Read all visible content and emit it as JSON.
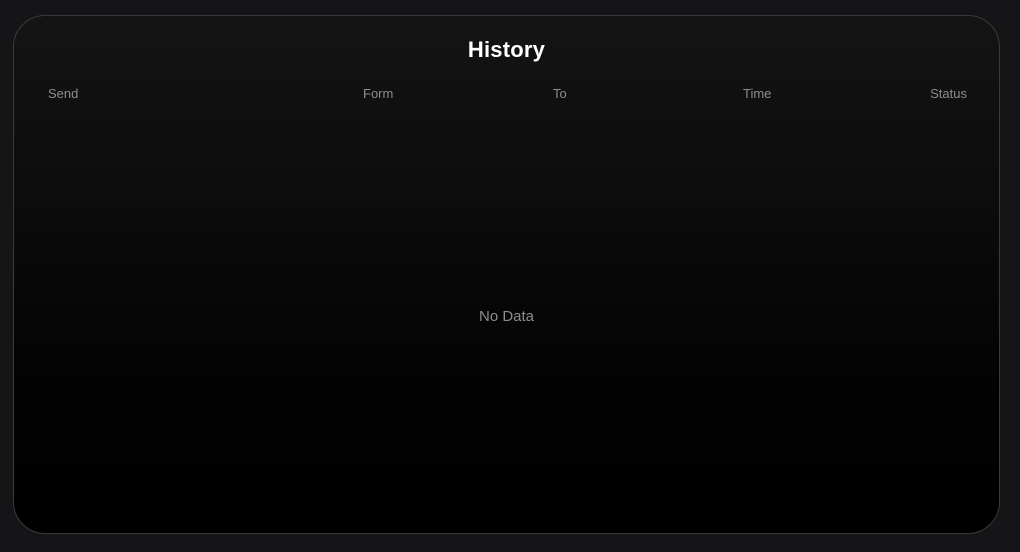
{
  "history": {
    "title": "History",
    "columns": [
      "Send",
      "Form",
      "To",
      "Time",
      "Status"
    ],
    "empty_text": "No Data"
  }
}
